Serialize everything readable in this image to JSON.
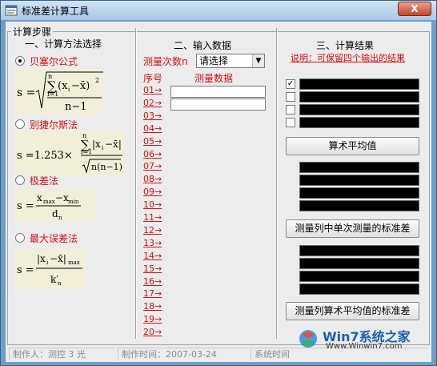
{
  "window": {
    "title": "标准差计算工具",
    "close_label": "X"
  },
  "steps": {
    "legend": "计算步骤",
    "method_section": {
      "title": "一、计算方法选择",
      "options": [
        {
          "label": "贝塞尔公式",
          "selected": true
        },
        {
          "label": "别捷尔斯法",
          "selected": false
        },
        {
          "label": "极差法",
          "selected": false
        },
        {
          "label": "最大误差法",
          "selected": false
        }
      ]
    },
    "input_section": {
      "title": "二、输入数据",
      "count_label": "测量次数n",
      "count_select_value": "请选择",
      "index_header": "序号",
      "data_header": "测量数据",
      "rows": [
        "01→",
        "02→",
        "03→",
        "04→",
        "05→",
        "06→",
        "07→",
        "08→",
        "09→",
        "10→",
        "11→",
        "12→",
        "13→",
        "14→",
        "15→",
        "16→",
        "17→",
        "18→",
        "19→",
        "20→"
      ]
    },
    "result_section": {
      "title": "三、计算结果",
      "note": "说明：可保留四个输出的结果",
      "checkbox_mark": "✓",
      "buttons": {
        "mean": "算术平均值",
        "single_std": "测量列中单次测量的标准差",
        "mean_std": "测量列算术平均值的标准差"
      }
    }
  },
  "statusbar": {
    "author": "制作人：测控 3 光",
    "time": "制作时间：2007-03-24",
    "sys": "系统时间"
  },
  "watermark": {
    "brand": "Win7系统之家",
    "url": "Www.Winwin7.com"
  }
}
